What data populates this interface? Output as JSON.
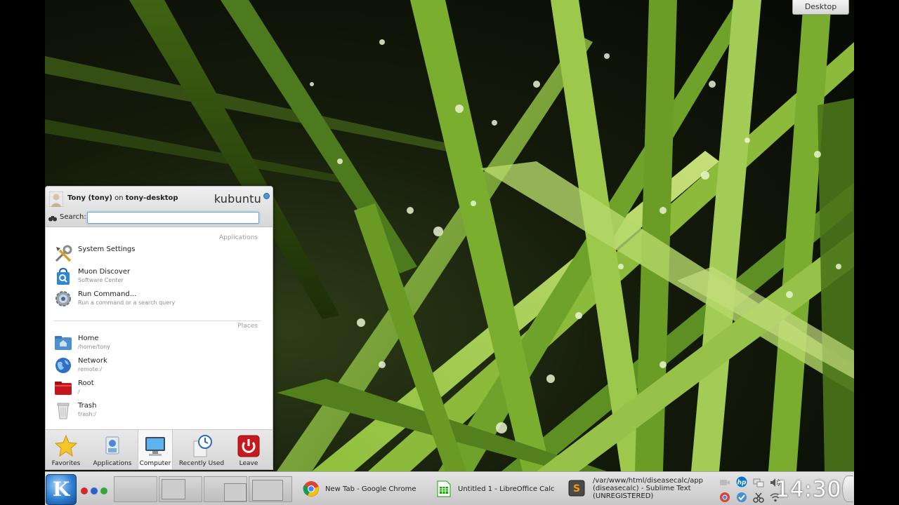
{
  "desktop": {
    "label": "Desktop"
  },
  "launcher": {
    "user": {
      "name": "Tony (tony)",
      "on": "on",
      "host": "tony-desktop"
    },
    "logo": "kubuntu",
    "search": {
      "label": "Search:",
      "value": "",
      "placeholder": ""
    },
    "sections": {
      "applications": "Applications",
      "places": "Places"
    },
    "applications": [
      {
        "title": "System Settings",
        "subtitle": "",
        "icon": "tools-icon"
      },
      {
        "title": "Muon Discover",
        "subtitle": "Software Center",
        "icon": "shopping-bag-icon"
      },
      {
        "title": "Run Command...",
        "subtitle": "Run a command or a search query",
        "icon": "gear-icon"
      }
    ],
    "places": [
      {
        "title": "Home",
        "subtitle": "/home/tony",
        "icon": "home-folder-icon"
      },
      {
        "title": "Network",
        "subtitle": "remote:/",
        "icon": "globe-icon"
      },
      {
        "title": "Root",
        "subtitle": "/",
        "icon": "red-folder-icon"
      },
      {
        "title": "Trash",
        "subtitle": "trash:/",
        "icon": "trash-icon"
      }
    ],
    "tabs": [
      {
        "label": "Favorites",
        "icon": "star-icon"
      },
      {
        "label": "Applications",
        "icon": "applications-icon"
      },
      {
        "label": "Computer",
        "icon": "monitor-icon",
        "active": true
      },
      {
        "label": "Recently Used",
        "icon": "clock-document-icon"
      },
      {
        "label": "Leave",
        "icon": "power-icon"
      }
    ]
  },
  "taskbar": {
    "tasks": [
      {
        "label": "New Tab - Google Chrome",
        "icon": "chrome-icon"
      },
      {
        "label": "Untitled 1 - LibreOffice Calc",
        "icon": "calc-icon"
      },
      {
        "line1": "/var/www/html/diseasecalc/app",
        "line2": "(diseasecalc) - Sublime Text",
        "line3": "(UNREGISTERED)",
        "icon": "sublime-icon"
      }
    ],
    "clock": "14:30"
  },
  "colors": {
    "accent": "#2f7fd1",
    "leave_red": "#c8191f",
    "taskbar": "#d6d6d6"
  }
}
